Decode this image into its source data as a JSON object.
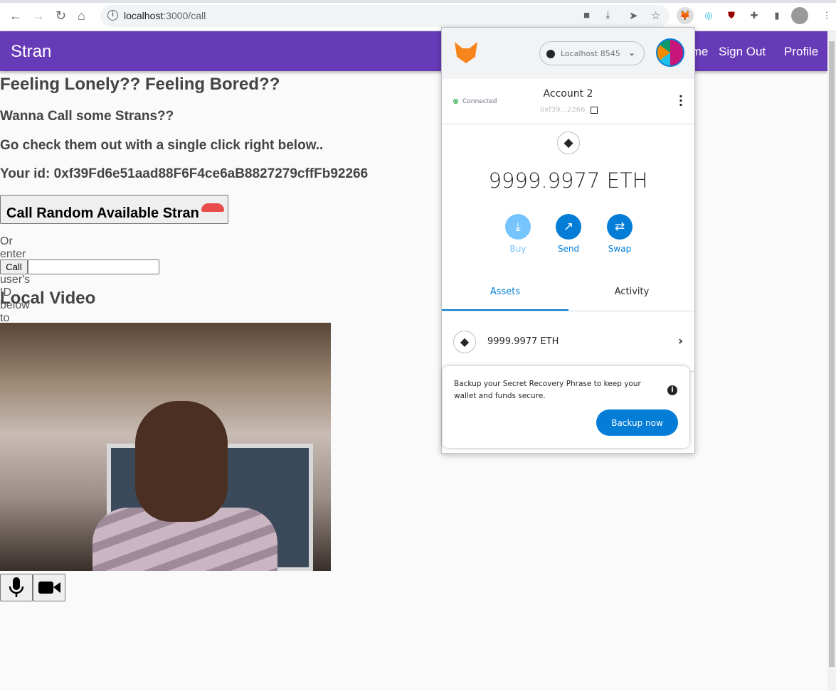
{
  "browser": {
    "url_host": "localhost",
    "url_path": ":3000/call"
  },
  "navbar": {
    "brand": "Stran",
    "links": [
      "Home",
      "Sign Out",
      "Profile"
    ]
  },
  "main": {
    "heading": "Feeling Lonely?? Feeling Bored??",
    "line1": "Wanna Call some Strans??",
    "line2": "Go check them out with a single click right below..",
    "your_id": "Your id: 0xf39Fd6e51aad88F6F4ce6aB8827279cffFb92266",
    "random_call_label": "Call Random Available Stran",
    "or_enter": "Or enter the user's ID below to call:",
    "call_label": "Call",
    "call_input_value": "",
    "local_video_title": "Local Video"
  },
  "metamask": {
    "network": "Localhost 8545",
    "status": "Connected",
    "account_name": "Account 2",
    "address": "0xf39...2266",
    "balance": "9999.9977 ETH",
    "actions": [
      "Buy",
      "Send",
      "Swap"
    ],
    "tabs": [
      "Assets",
      "Activity"
    ],
    "active_tab": "Assets",
    "asset": "9999.9977 ETH",
    "backup_message": "Backup your Secret Recovery Phrase to keep your wallet and funds secure.",
    "backup_button": "Backup now",
    "accent": "#037dd6"
  },
  "colors": {
    "appbar": "#673ab7"
  }
}
